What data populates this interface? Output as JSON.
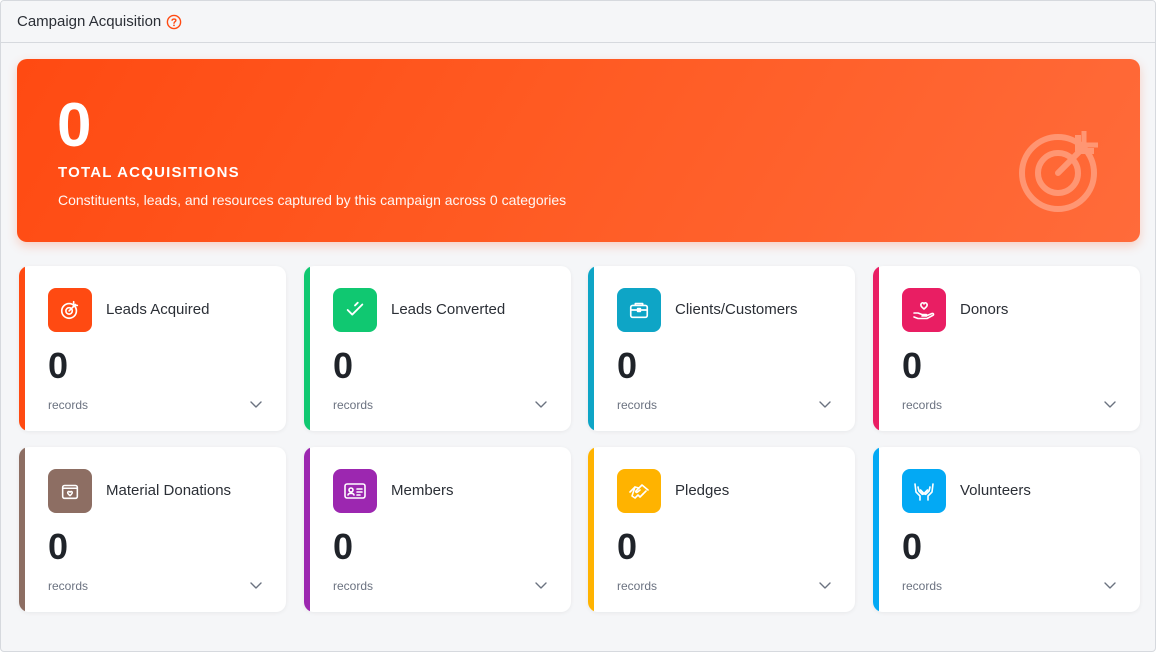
{
  "header": {
    "title": "Campaign Acquisition"
  },
  "hero": {
    "value": "0",
    "label": "TOTAL ACQUISITIONS",
    "description": "Constituents, leads, and resources captured by this campaign across 0 categories"
  },
  "cards": [
    {
      "title": "Leads Acquired",
      "value": "0",
      "unit": "records",
      "color": "#ff4a12",
      "icon": "target-icon"
    },
    {
      "title": "Leads Converted",
      "value": "0",
      "unit": "records",
      "color": "#10c871",
      "icon": "double-check-icon"
    },
    {
      "title": "Clients/Customers",
      "value": "0",
      "unit": "records",
      "color": "#0ea5c6",
      "icon": "briefcase-icon"
    },
    {
      "title": "Donors",
      "value": "0",
      "unit": "records",
      "color": "#e91e63",
      "icon": "hand-heart-icon"
    },
    {
      "title": "Material Donations",
      "value": "0",
      "unit": "records",
      "color": "#8d6e63",
      "icon": "gift-box-icon"
    },
    {
      "title": "Members",
      "value": "0",
      "unit": "records",
      "color": "#9c27b0",
      "icon": "id-card-icon"
    },
    {
      "title": "Pledges",
      "value": "0",
      "unit": "records",
      "color": "#ffb300",
      "icon": "handshake-icon"
    },
    {
      "title": "Volunteers",
      "value": "0",
      "unit": "records",
      "color": "#03a9f4",
      "icon": "raised-hands-icon"
    }
  ]
}
